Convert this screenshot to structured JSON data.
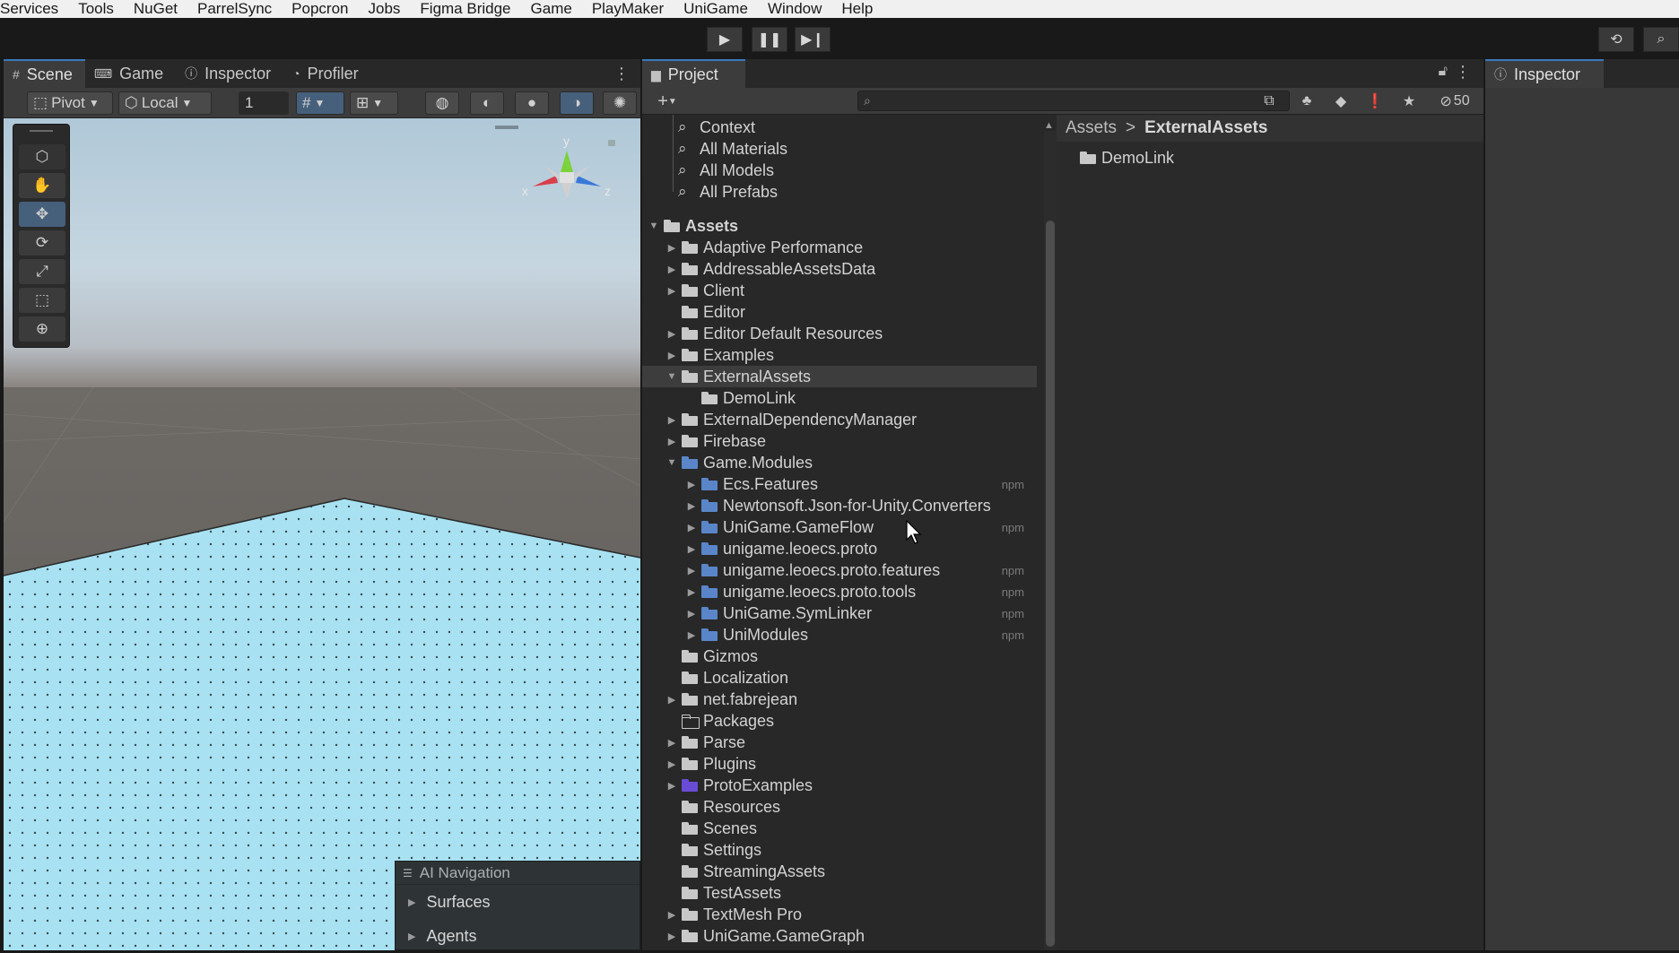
{
  "menubar": {
    "items": [
      "Services",
      "Tools",
      "NuGet",
      "ParrelSync",
      "Popcron",
      "Jobs",
      "Figma Bridge",
      "Game",
      "PlayMaker",
      "UniGame",
      "Window",
      "Help"
    ]
  },
  "toolbar": {
    "play_icon": "play-icon",
    "pause_icon": "pause-icon",
    "step_icon": "step-icon"
  },
  "scene_panel": {
    "tabs": [
      {
        "label": "Scene",
        "icon": "grid-icon",
        "active": true
      },
      {
        "label": "Game",
        "icon": "gamepad-icon",
        "active": false
      },
      {
        "label": "Inspector",
        "icon": "info-icon",
        "active": false
      },
      {
        "label": "Profiler",
        "icon": "profiler-icon",
        "active": false
      }
    ],
    "tools": {
      "pivot_label": "Pivot",
      "local_label": "Local",
      "grid_value": "1"
    },
    "gizmo_axes": {
      "y": "y",
      "x": "x",
      "z": "z"
    },
    "ai_navigation": {
      "title": "AI Navigation",
      "items": [
        "Surfaces",
        "Agents"
      ]
    }
  },
  "project_panel": {
    "tab_label": "Project",
    "hidden_count": "50",
    "favorites": [
      "Context",
      "All Materials",
      "All Models",
      "All Prefabs"
    ],
    "tree": [
      {
        "label": "Assets",
        "level": 0,
        "arrow": "down",
        "icon": "open",
        "bold": true
      },
      {
        "label": "Adaptive Performance",
        "level": 1,
        "arrow": "right",
        "icon": "folder"
      },
      {
        "label": "AddressableAssetsData",
        "level": 1,
        "arrow": "right",
        "icon": "folder"
      },
      {
        "label": "Client",
        "level": 1,
        "arrow": "right",
        "icon": "folder"
      },
      {
        "label": "Editor",
        "level": 1,
        "arrow": "",
        "icon": "doc"
      },
      {
        "label": "Editor Default Resources",
        "level": 1,
        "arrow": "right",
        "icon": "doc"
      },
      {
        "label": "Examples",
        "level": 1,
        "arrow": "right",
        "icon": "folder"
      },
      {
        "label": "ExternalAssets",
        "level": 1,
        "arrow": "down",
        "icon": "open",
        "selected": true
      },
      {
        "label": "DemoLink",
        "level": 2,
        "arrow": "",
        "icon": "folder"
      },
      {
        "label": "ExternalDependencyManager",
        "level": 1,
        "arrow": "right",
        "icon": "folder"
      },
      {
        "label": "Firebase",
        "level": 1,
        "arrow": "right",
        "icon": "folder"
      },
      {
        "label": "Game.Modules",
        "level": 1,
        "arrow": "down",
        "icon": "blue"
      },
      {
        "label": "Ecs.Features",
        "level": 2,
        "arrow": "right",
        "icon": "blue",
        "npm": "npm"
      },
      {
        "label": "Newtonsoft.Json-for-Unity.Converters",
        "level": 2,
        "arrow": "right",
        "icon": "blue"
      },
      {
        "label": "UniGame.GameFlow",
        "level": 2,
        "arrow": "right",
        "icon": "blue",
        "npm": "npm"
      },
      {
        "label": "unigame.leoecs.proto",
        "level": 2,
        "arrow": "right",
        "icon": "blue"
      },
      {
        "label": "unigame.leoecs.proto.features",
        "level": 2,
        "arrow": "right",
        "icon": "blue",
        "npm": "npm"
      },
      {
        "label": "unigame.leoecs.proto.tools",
        "level": 2,
        "arrow": "right",
        "icon": "blue",
        "npm": "npm"
      },
      {
        "label": "UniGame.SymLinker",
        "level": 2,
        "arrow": "right",
        "icon": "blue",
        "npm": "npm"
      },
      {
        "label": "UniModules",
        "level": 2,
        "arrow": "right",
        "icon": "blue",
        "npm": "npm"
      },
      {
        "label": "Gizmos",
        "level": 1,
        "arrow": "",
        "icon": "folder"
      },
      {
        "label": "Localization",
        "level": 1,
        "arrow": "",
        "icon": "folder"
      },
      {
        "label": "net.fabrejean",
        "level": 1,
        "arrow": "right",
        "icon": "folder"
      },
      {
        "label": "Packages",
        "level": 1,
        "arrow": "",
        "icon": "outline"
      },
      {
        "label": "Parse",
        "level": 1,
        "arrow": "right",
        "icon": "folder"
      },
      {
        "label": "Plugins",
        "level": 1,
        "arrow": "right",
        "icon": "plugin"
      },
      {
        "label": "ProtoExamples",
        "level": 1,
        "arrow": "right",
        "icon": "purple"
      },
      {
        "label": "Resources",
        "level": 1,
        "arrow": "",
        "icon": "doc"
      },
      {
        "label": "Scenes",
        "level": 1,
        "arrow": "",
        "icon": "scene"
      },
      {
        "label": "Settings",
        "level": 1,
        "arrow": "",
        "icon": "folder"
      },
      {
        "label": "StreamingAssets",
        "level": 1,
        "arrow": "",
        "icon": "folder"
      },
      {
        "label": "TestAssets",
        "level": 1,
        "arrow": "",
        "icon": "folder"
      },
      {
        "label": "TextMesh Pro",
        "level": 1,
        "arrow": "right",
        "icon": "folder"
      },
      {
        "label": "UniGame.GameGraph",
        "level": 1,
        "arrow": "right",
        "icon": "folder"
      }
    ],
    "breadcrumb": {
      "root": "Assets",
      "separator": ">",
      "current": "ExternalAssets"
    },
    "contents": [
      {
        "label": "DemoLink",
        "icon": "folder"
      }
    ]
  },
  "inspector_panel": {
    "tab_label": "Inspector"
  }
}
